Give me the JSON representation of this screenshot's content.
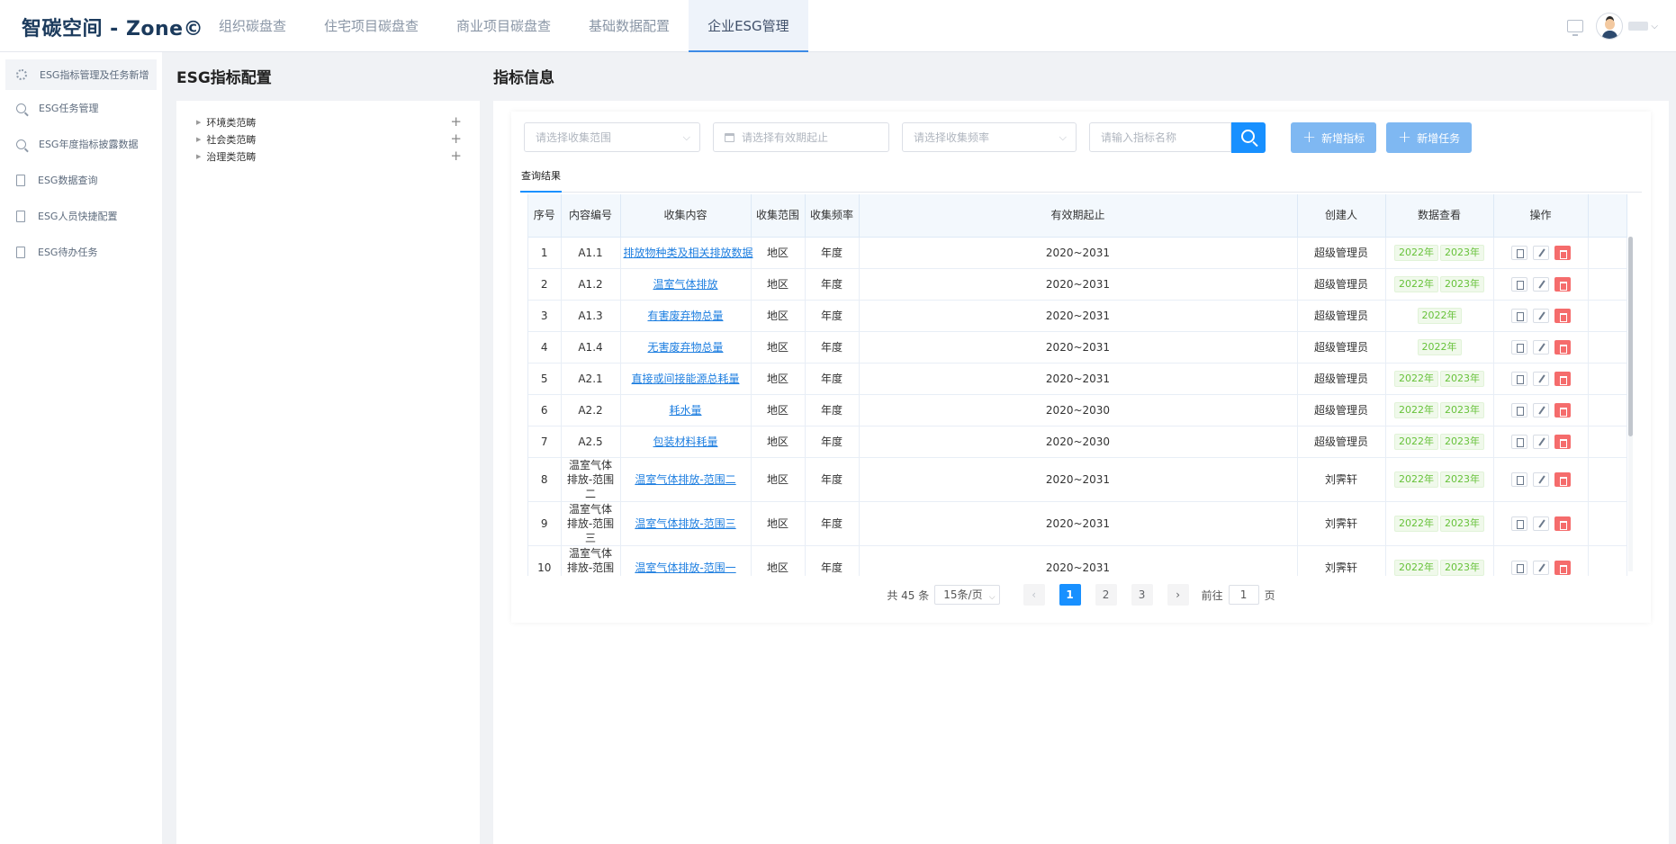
{
  "header": {
    "logo": "智碳空间 - Zone©",
    "nav": [
      "组织碳盘查",
      "住宅项目碳盘查",
      "商业项目碳盘查",
      "基础数据配置",
      "企业ESG管理"
    ]
  },
  "sidebar": {
    "items": [
      {
        "label": "ESG指标管理及任务新增",
        "icon": "gear-icon"
      },
      {
        "label": "ESG任务管理",
        "icon": "search-icon"
      },
      {
        "label": "ESG年度指标披露数据",
        "icon": "search-icon"
      },
      {
        "label": "ESG数据查询",
        "icon": "document-icon"
      },
      {
        "label": "ESG人员快捷配置",
        "icon": "document-icon"
      },
      {
        "label": "ESG待办任务",
        "icon": "document-icon"
      }
    ]
  },
  "config_panel": {
    "title": "ESG指标配置",
    "tree": [
      "环境类范畴",
      "社会类范畴",
      "治理类范畴"
    ]
  },
  "main": {
    "title": "指标信息",
    "filters": {
      "scope_placeholder": "请选择收集范围",
      "date_placeholder": "请选择有效期起止",
      "freq_placeholder": "请选择收集频率",
      "name_placeholder": "请输入指标名称"
    },
    "buttons": {
      "add_indicator": "新增指标",
      "add_task": "新增任务"
    },
    "tab": "查询结果",
    "columns": [
      "序号",
      "内容编号",
      "收集内容",
      "收集范围",
      "收集频率",
      "有效期起止",
      "创建人",
      "数据查看",
      "操作"
    ],
    "rows": [
      {
        "no": "1",
        "code": "A1.1",
        "content": "排放物种类及相关排放数据",
        "scope": "地区",
        "freq": "年度",
        "period": "2020~2031",
        "creator": "超级管理员",
        "years": [
          "2022年",
          "2023年"
        ]
      },
      {
        "no": "2",
        "code": "A1.2",
        "content": "温室气体排放",
        "scope": "地区",
        "freq": "年度",
        "period": "2020~2031",
        "creator": "超级管理员",
        "years": [
          "2022年",
          "2023年"
        ]
      },
      {
        "no": "3",
        "code": "A1.3",
        "content": "有害废弃物总量",
        "scope": "地区",
        "freq": "年度",
        "period": "2020~2031",
        "creator": "超级管理员",
        "years": [
          "2022年"
        ]
      },
      {
        "no": "4",
        "code": "A1.4",
        "content": "无害废弃物总量",
        "scope": "地区",
        "freq": "年度",
        "period": "2020~2031",
        "creator": "超级管理员",
        "years": [
          "2022年"
        ]
      },
      {
        "no": "5",
        "code": "A2.1",
        "content": "直接或间接能源总耗量",
        "scope": "地区",
        "freq": "年度",
        "period": "2020~2031",
        "creator": "超级管理员",
        "years": [
          "2022年",
          "2023年"
        ]
      },
      {
        "no": "6",
        "code": "A2.2",
        "content": "耗水量",
        "scope": "地区",
        "freq": "年度",
        "period": "2020~2030",
        "creator": "超级管理员",
        "years": [
          "2022年",
          "2023年"
        ]
      },
      {
        "no": "7",
        "code": "A2.5",
        "content": "包装材料耗量",
        "scope": "地区",
        "freq": "年度",
        "period": "2020~2030",
        "creator": "超级管理员",
        "years": [
          "2022年",
          "2023年"
        ]
      },
      {
        "no": "8",
        "code": "温室气体排放-范围二",
        "content": "温室气体排放-范围二",
        "scope": "地区",
        "freq": "年度",
        "period": "2020~2031",
        "creator": "刘霁轩",
        "years": [
          "2022年",
          "2023年"
        ]
      },
      {
        "no": "9",
        "code": "温室气体排放-范围三",
        "content": "温室气体排放-范围三",
        "scope": "地区",
        "freq": "年度",
        "period": "2020~2031",
        "creator": "刘霁轩",
        "years": [
          "2022年",
          "2023年"
        ]
      },
      {
        "no": "10",
        "code": "温室气体排放-范围一",
        "content": "温室气体排放-范围一",
        "scope": "地区",
        "freq": "年度",
        "period": "2020~2031",
        "creator": "刘霁轩",
        "years": [
          "2022年",
          "2023年"
        ]
      }
    ],
    "pagination": {
      "total": "共 45 条",
      "page_size": "15条/页",
      "pages": [
        "1",
        "2",
        "3"
      ],
      "current": "1",
      "goto_label": "前往",
      "goto_value": "1",
      "page_suffix": "页",
      "prev": "‹",
      "next": "›"
    }
  },
  "colors": {
    "primary": "#1890ff",
    "accent_light": "#7fb8f2",
    "success": "#67c23a",
    "danger": "#f56c6c"
  }
}
